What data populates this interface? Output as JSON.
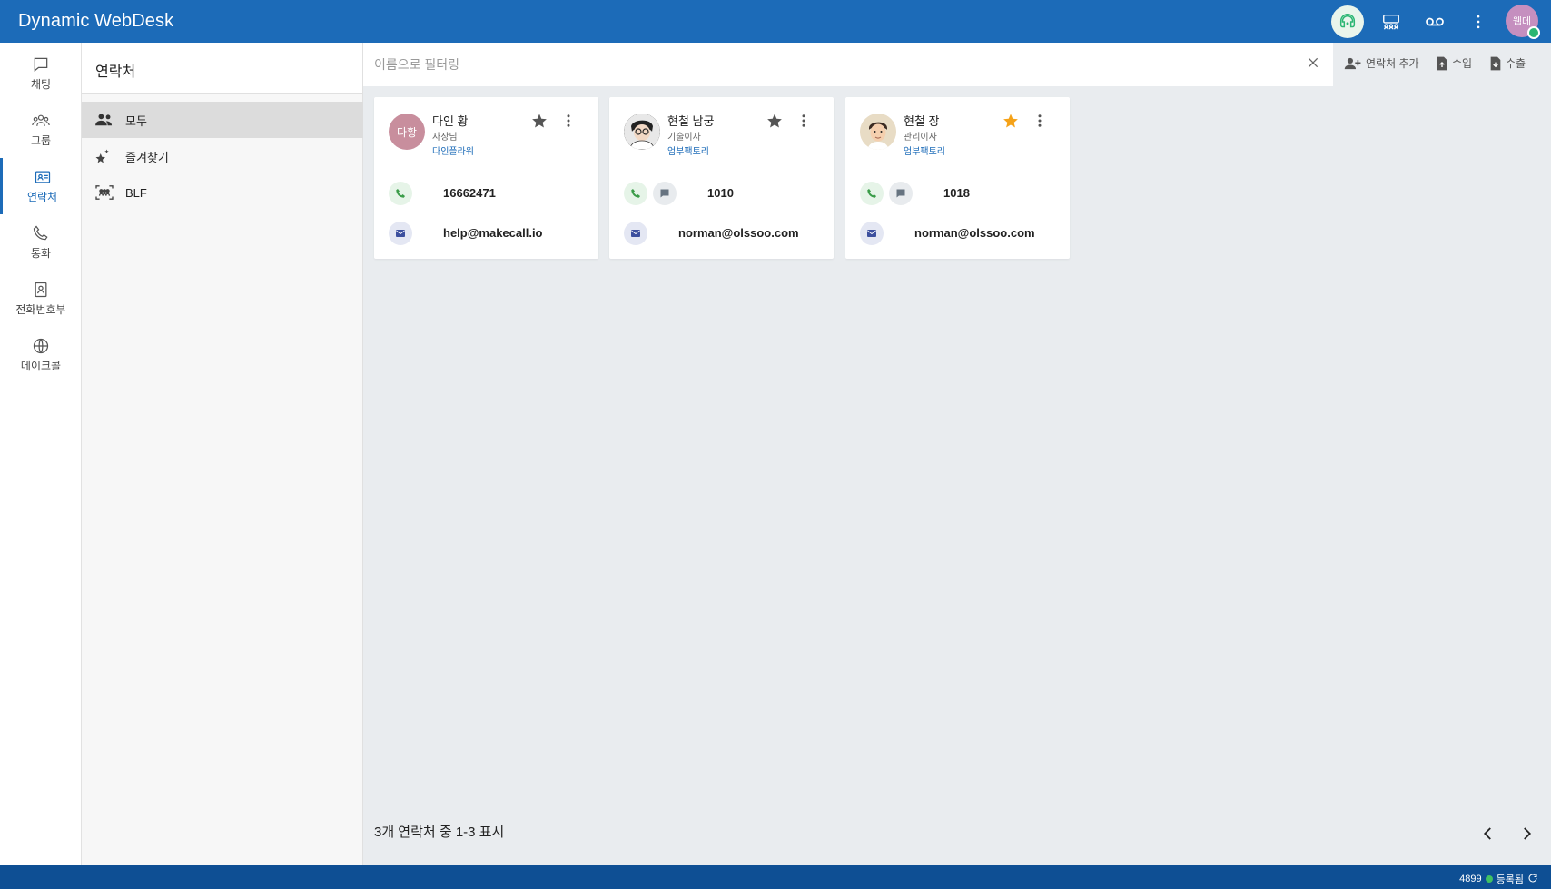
{
  "app": {
    "title": "Dynamic WebDesk"
  },
  "topbar": {
    "icons": [
      "headset-icon",
      "group-grid-icon",
      "voicemail-icon",
      "more-vert-icon"
    ],
    "avatar_initials": "웹데",
    "colors": {
      "bar": "#1c6bb8",
      "avatar": "#c58fbf",
      "online": "#2bb673"
    }
  },
  "leftnav": {
    "items": [
      {
        "label": "채팅",
        "icon": "chat-icon"
      },
      {
        "label": "그룹",
        "icon": "group-icon"
      },
      {
        "label": "연락처",
        "icon": "contact-card-icon",
        "active": true
      },
      {
        "label": "통화",
        "icon": "phone-icon"
      },
      {
        "label": "전화번호부",
        "icon": "phonebook-icon"
      },
      {
        "label": "메이크콜",
        "icon": "globe-icon"
      }
    ]
  },
  "sidebar": {
    "title": "연락처",
    "items": [
      {
        "label": "모두",
        "icon": "people-icon",
        "active": true
      },
      {
        "label": "즐겨찾기",
        "icon": "star-sparkle-icon"
      },
      {
        "label": "BLF",
        "icon": "blf-frame-icon"
      }
    ]
  },
  "search": {
    "placeholder": "이름으로 필터링",
    "value": ""
  },
  "actions": {
    "add_contact": "연락처 추가",
    "import": "수입",
    "export": "수출"
  },
  "contacts": [
    {
      "name": "다인 황",
      "title": "사장님",
      "company": "다인플라워",
      "avatar_text": "다황",
      "favorite": false,
      "number": "16662471",
      "email": "help@makecall.io",
      "has_message": false
    },
    {
      "name": "현철 남궁",
      "title": "기술이사",
      "company": "엄부팩토리",
      "avatar_text": "",
      "favorite": false,
      "number": "1010",
      "email": "norman@olssoo.com",
      "has_message": true
    },
    {
      "name": "현철 장",
      "title": "관리이사",
      "company": "엄부팩토리",
      "avatar_text": "",
      "favorite": true,
      "number": "1018",
      "email": "norman@olssoo.com",
      "has_message": true
    }
  ],
  "pager": {
    "text": "3개 연락처 중 1-3 표시"
  },
  "status": {
    "extension": "4899",
    "state": "등록됨"
  }
}
